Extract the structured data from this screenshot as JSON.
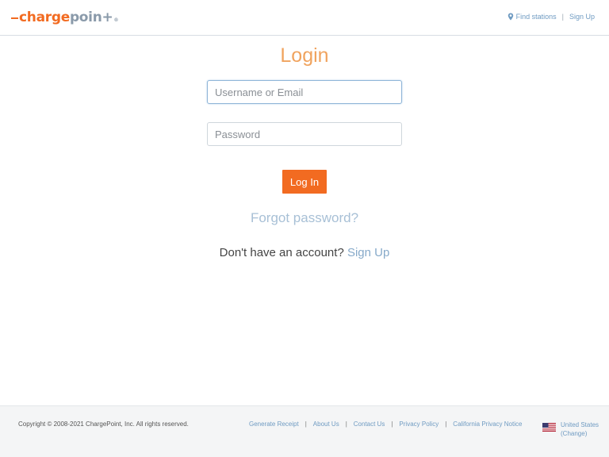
{
  "header": {
    "logo": {
      "part1": "charge",
      "part2": "poin"
    },
    "nav": {
      "find_stations": "Find stations",
      "separator": "|",
      "sign_up": "Sign Up"
    }
  },
  "main": {
    "title": "Login",
    "username": {
      "placeholder": "Username or Email",
      "value": ""
    },
    "password": {
      "placeholder": "Password",
      "value": ""
    },
    "login_button": "Log In",
    "forgot_password": "Forgot password?",
    "no_account_text": "Don't have an account?",
    "sign_up_link": "Sign Up"
  },
  "footer": {
    "copyright": "Copyright © 2008-2021 ChargePoint, Inc. All rights reserved.",
    "links": {
      "generate_receipt": "Generate Receipt",
      "about_us": "About Us",
      "contact_us": "Contact Us",
      "privacy_policy": "Privacy Policy",
      "california_privacy": "California Privacy Notice"
    },
    "separator": "|",
    "region": {
      "country": "United States",
      "change": "(Change)"
    }
  },
  "colors": {
    "brand_orange": "#f26b21",
    "title_orange": "#f0a35e",
    "link_blue": "#6f9bc2",
    "logo_gray": "#8a9aaa"
  },
  "icons": {
    "location": "map-pin-icon",
    "flag": "us-flag-icon"
  }
}
